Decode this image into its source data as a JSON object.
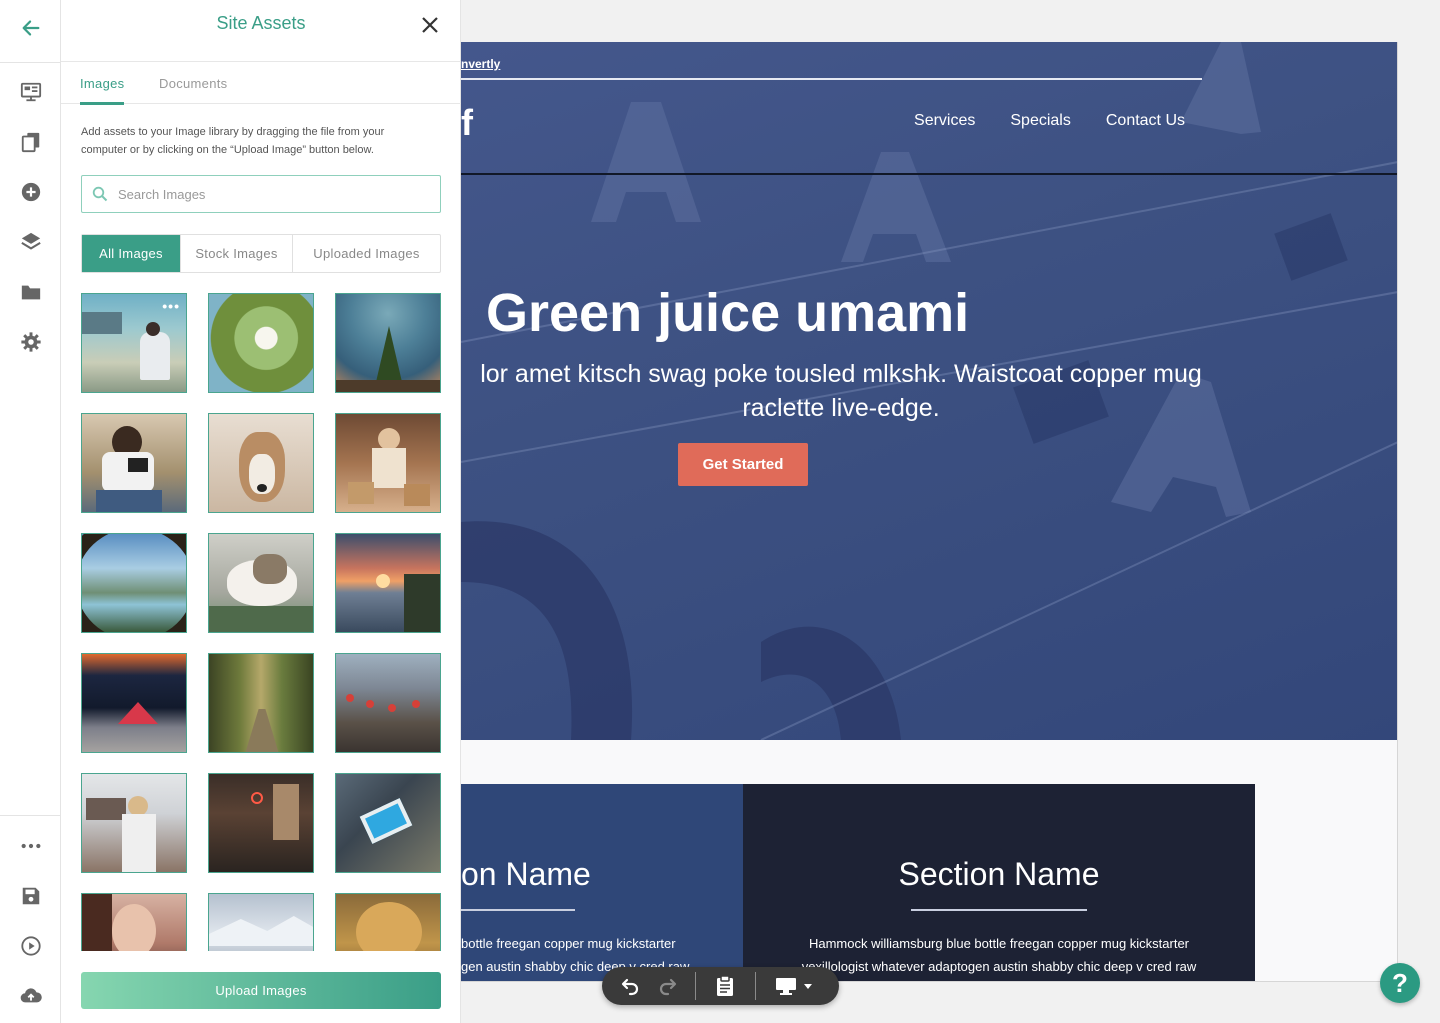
{
  "panel": {
    "title": "Site Assets",
    "tabs": [
      {
        "label": "Images",
        "active": true
      },
      {
        "label": "Documents",
        "active": false
      }
    ],
    "help_text": "Add assets to your Image library by dragging the file from your computer or by clicking on the “Upload Image” button below.",
    "search_placeholder": "Search Images",
    "filters": [
      {
        "label": "All Images",
        "active": true
      },
      {
        "label": "Stock Images",
        "active": false
      },
      {
        "label": "Uploaded Images",
        "active": false
      }
    ],
    "thumbnails": [
      {
        "subject": "man-on-beach"
      },
      {
        "subject": "white-flower-leaves"
      },
      {
        "subject": "star-trails-tree"
      },
      {
        "subject": "man-with-camera"
      },
      {
        "subject": "dog-portrait"
      },
      {
        "subject": "woman-with-shopping-bags"
      },
      {
        "subject": "lake-view-from-tent"
      },
      {
        "subject": "cat-lying"
      },
      {
        "subject": "sunset-over-sea"
      },
      {
        "subject": "red-tent-night"
      },
      {
        "subject": "forest-road"
      },
      {
        "subject": "asian-street-lanterns"
      },
      {
        "subject": "woman-city-street"
      },
      {
        "subject": "dim-interior"
      },
      {
        "subject": "pool-aerial"
      },
      {
        "subject": "woman-portrait"
      },
      {
        "subject": "snowy-mountain"
      },
      {
        "subject": "lion"
      }
    ],
    "upload_label": "Upload Images"
  },
  "canvas": {
    "brand": "nvertly",
    "logo_fragment": "f",
    "nav": [
      "Services",
      "Specials",
      "Contact Us"
    ],
    "hero_title": "Green juice umami",
    "hero_subtitle_line1": "lor amet kitsch swag poke tousled mlkshk. Waistcoat copper mug",
    "hero_subtitle_line2": "raclette live-edge.",
    "cta_label": "Get Started",
    "section_left": {
      "title": "on Name",
      "text_line1": "bottle freegan copper mug kickstarter",
      "text_line2": "gen austin shabby chic deep v cred raw"
    },
    "section_right": {
      "title": "Section Name",
      "text_line1": "Hammock williamsburg blue bottle freegan copper mug kickstarter",
      "text_line2": "vexillologist whatever adaptogen austin shabby chic deep v cred raw"
    }
  },
  "colors": {
    "accent": "#3a9e87",
    "hero_overlay": "#3d5182",
    "cta": "#e06b59",
    "section_dark": "#1d2234",
    "section_blue": "#2f4778"
  },
  "icons": [
    "back-arrow-icon",
    "layout-icon",
    "pages-icon",
    "add-icon",
    "layers-icon",
    "folder-icon",
    "gear-icon",
    "more-icon",
    "save-icon",
    "play-icon",
    "cloud-upload-icon",
    "close-icon",
    "search-icon",
    "undo-icon",
    "redo-icon",
    "clipboard-icon",
    "desktop-icon",
    "dropdown-caret-icon",
    "help-icon"
  ],
  "help_fab": "?"
}
